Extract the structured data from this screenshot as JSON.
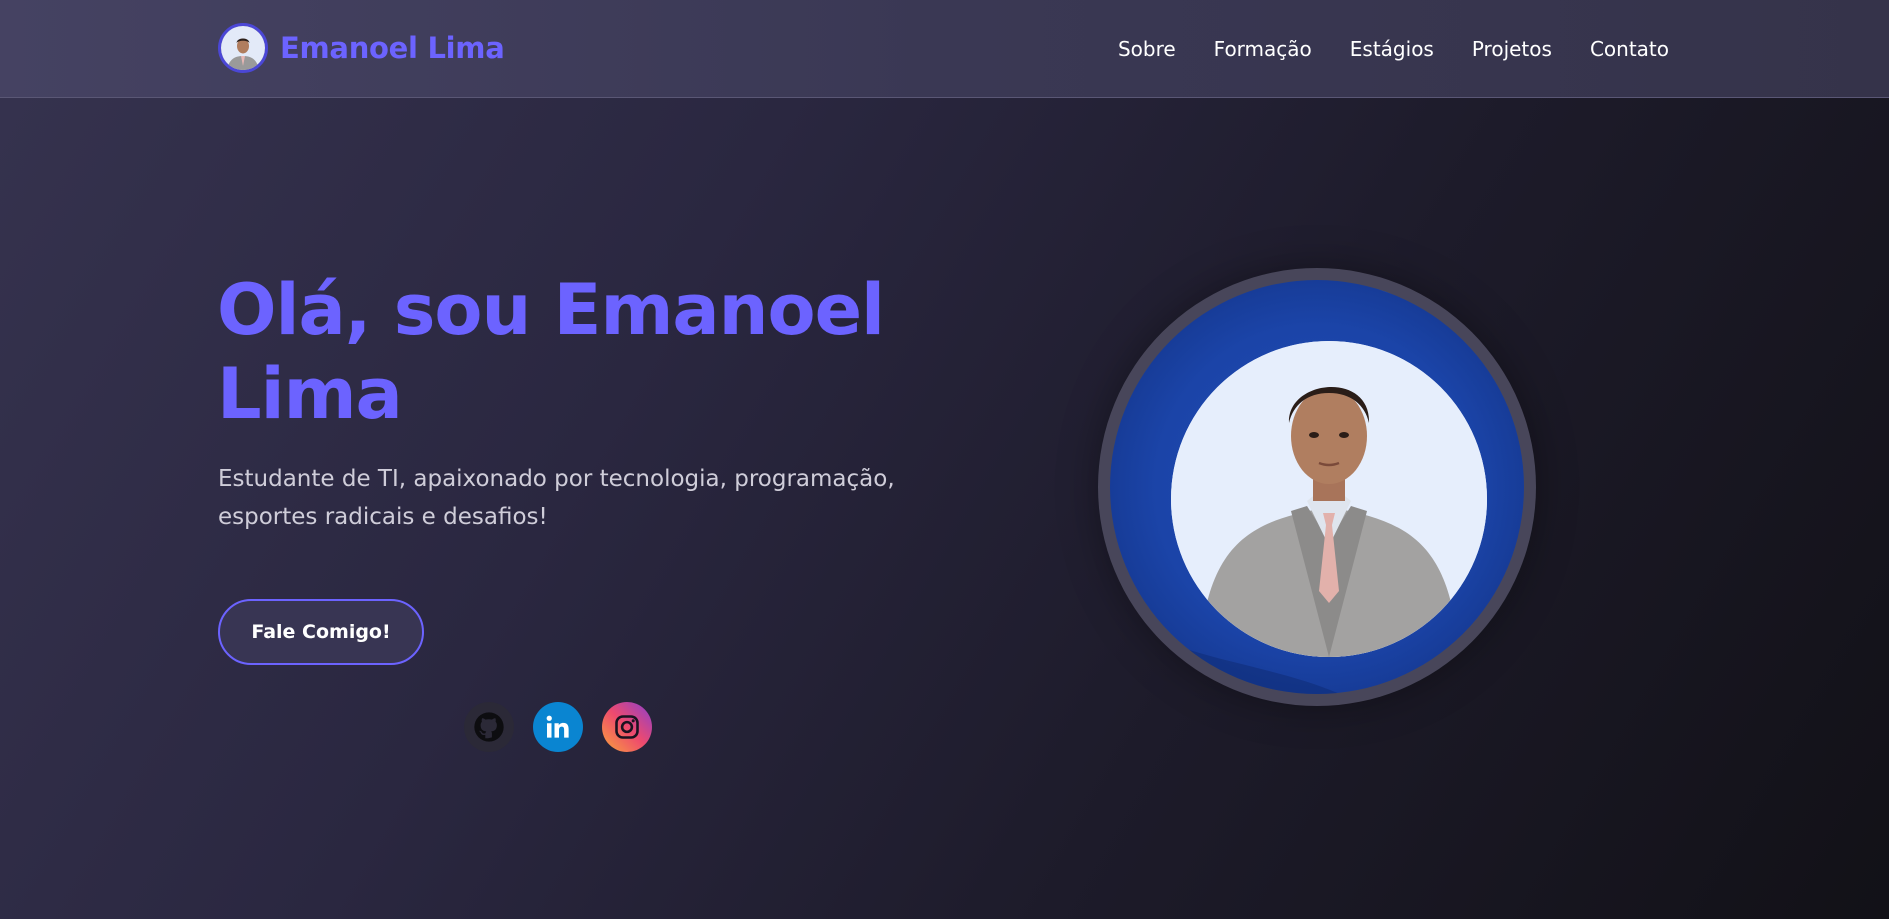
{
  "brand": {
    "name": "Emanoel Lima",
    "avatar_icon": "profile-photo"
  },
  "nav": {
    "items": [
      "Sobre",
      "Formação",
      "Estágios",
      "Projetos",
      "Contato"
    ]
  },
  "hero": {
    "title": "Olá, sou Emanoel Lima",
    "subtitle": "Estudante de TI, apaixonado por tecnologia, programação, esportes radicais e desafios!",
    "cta_label": "Fale Comigo!"
  },
  "socials": [
    {
      "icon": "github-icon"
    },
    {
      "icon": "linkedin-icon"
    },
    {
      "icon": "instagram-icon"
    }
  ],
  "colors": {
    "accent": "#6c63ff",
    "navbar": "#3f3d5a",
    "background": "#2a2740",
    "linkedin": "#0a85d1",
    "portrait_ring_blue": "#1b44a8"
  }
}
